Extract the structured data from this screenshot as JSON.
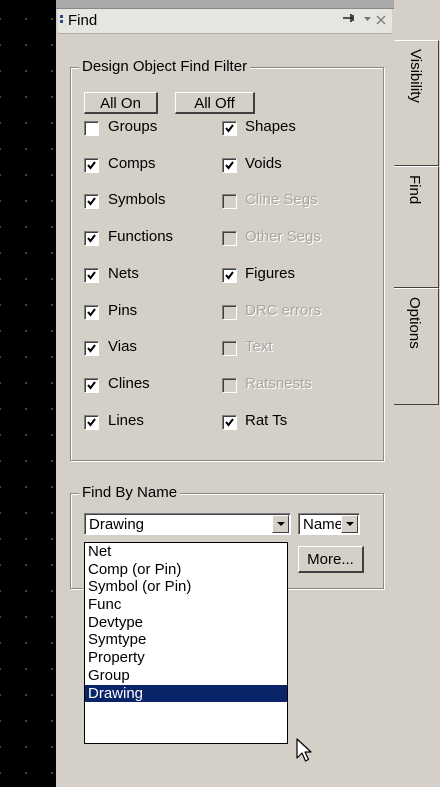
{
  "panel": {
    "title": "Find",
    "pin_glyph": "⊕",
    "menu_glyph": "▼",
    "close_glyph": "×"
  },
  "filter_group": {
    "title": "Design Object Find Filter",
    "all_on_label": "All On",
    "all_off_label": "All Off",
    "left_column": [
      {
        "label": "Groups",
        "checked": false,
        "enabled": true
      },
      {
        "label": "Comps",
        "checked": true,
        "enabled": true
      },
      {
        "label": "Symbols",
        "checked": true,
        "enabled": true
      },
      {
        "label": "Functions",
        "checked": true,
        "enabled": true
      },
      {
        "label": "Nets",
        "checked": true,
        "enabled": true
      },
      {
        "label": "Pins",
        "checked": true,
        "enabled": true
      },
      {
        "label": "Vias",
        "checked": true,
        "enabled": true
      },
      {
        "label": "Clines",
        "checked": true,
        "enabled": true
      },
      {
        "label": "Lines",
        "checked": true,
        "enabled": true
      }
    ],
    "right_column": [
      {
        "label": "Shapes",
        "checked": true,
        "enabled": true
      },
      {
        "label": "Voids",
        "checked": true,
        "enabled": true
      },
      {
        "label": "Cline Segs",
        "checked": false,
        "enabled": false
      },
      {
        "label": "Other Segs",
        "checked": false,
        "enabled": false
      },
      {
        "label": "Figures",
        "checked": true,
        "enabled": true
      },
      {
        "label": "DRC errors",
        "checked": false,
        "enabled": false
      },
      {
        "label": "Text",
        "checked": false,
        "enabled": false
      },
      {
        "label": "Ratsnests",
        "checked": false,
        "enabled": false
      },
      {
        "label": "Rat Ts",
        "checked": true,
        "enabled": true
      }
    ]
  },
  "find_by_name": {
    "title": "Find By Name",
    "type_value": "Drawing",
    "mode_value": "Name",
    "more_label": "More...",
    "options": [
      "Net",
      "Comp (or Pin)",
      "Symbol (or Pin)",
      "Func",
      "Devtype",
      "Symtype",
      "Property",
      "Group",
      "Drawing"
    ],
    "selected_index": 8
  },
  "side_tabs": [
    "Visibility",
    "Find",
    "Options"
  ]
}
